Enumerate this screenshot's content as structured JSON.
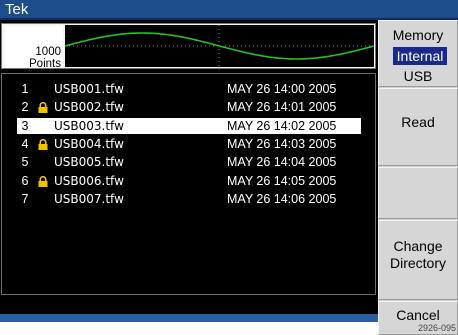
{
  "window": {
    "title": "Tek"
  },
  "waveform": {
    "points_value": "1000",
    "points_unit": "Points"
  },
  "file_list": {
    "rows": [
      {
        "index": "1",
        "locked": false,
        "name": "USB001.tfw",
        "date": "MAY 26 14:00 2005",
        "selected": false
      },
      {
        "index": "2",
        "locked": true,
        "name": "USB002.tfw",
        "date": "MAY 26 14:01 2005",
        "selected": false
      },
      {
        "index": "3",
        "locked": false,
        "name": "USB003.tfw",
        "date": "MAY 26 14:02 2005",
        "selected": true
      },
      {
        "index": "4",
        "locked": true,
        "name": "USB004.tfw",
        "date": "MAY 26 14:03 2005",
        "selected": false
      },
      {
        "index": "5",
        "locked": false,
        "name": "USB005.tfw",
        "date": "MAY 26 14:04 2005",
        "selected": false
      },
      {
        "index": "6",
        "locked": true,
        "name": "USB006.tfw",
        "date": "MAY 26 14:05 2005",
        "selected": false
      },
      {
        "index": "7",
        "locked": false,
        "name": "USB007.tfw",
        "date": "MAY 26 14:06 2005",
        "selected": false
      }
    ]
  },
  "softkeys": {
    "memory_label": "Memory",
    "memory_options": [
      "Internal",
      "USB"
    ],
    "memory_selected": "Internal",
    "read_label": "Read",
    "change_dir_line1": "Change",
    "change_dir_line2": "Directory",
    "cancel_label": "Cancel"
  },
  "figure_id": "2926-095",
  "icons": {
    "lock": "lock-icon"
  },
  "colors": {
    "title_bar": "#1c4c8a",
    "waveform_trace": "#22c322",
    "selection_bg": "#ffffff",
    "lock_icon": "#f2c200",
    "internal_highlight": "#1a2a8c"
  }
}
